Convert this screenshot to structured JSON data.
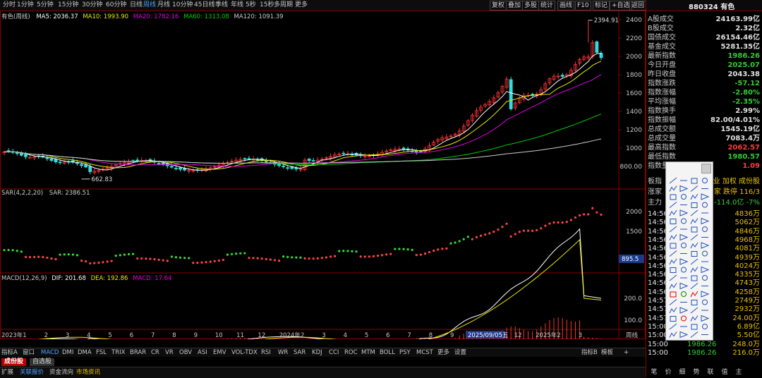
{
  "topbar": {
    "tabs": [
      "分时",
      "1分钟",
      "5分钟",
      "15分钟",
      "30分钟",
      "60分钟",
      "日线",
      "周线",
      "月线",
      "10分钟",
      "45日线",
      "季线",
      "年线",
      "5秒",
      "15秒",
      "多周期",
      "更多"
    ],
    "active": "周线",
    "buttons": [
      "复权",
      "叠加",
      "多股",
      "统计",
      "画线",
      "F10",
      "标记",
      "+自选",
      "返回"
    ]
  },
  "main_legend": {
    "name": "有色(周线)",
    "ma5": "MA5: 2036.37",
    "ma10": "MA10: 1993.90",
    "ma20": "MA20: 1782.16",
    "ma60": "MA60: 1313.08",
    "ma120": "MA120: 1091.39"
  },
  "sar_legend": {
    "name": "SAR(4,2,2,20)",
    "value": "SAR: 2386.51"
  },
  "macd_legend": {
    "name": "MACD(12,26,9)",
    "dif": "DIF: 201.68",
    "dea": "DEA: 192.86",
    "macd": "MACD: 17.64"
  },
  "axis": {
    "price_ticks": [
      "2400",
      "2200",
      "2000",
      "1800",
      "1600",
      "1400",
      "1200",
      "1000",
      "800.00"
    ],
    "sar_ticks": [
      "2000",
      "1500"
    ],
    "sar_box": "895.5",
    "macd_ticks": [
      "200.0",
      "100.0"
    ],
    "high_label": "2394.91",
    "low_label": "662.83",
    "time_labels": [
      "2023年",
      "1",
      "2",
      "3",
      "4",
      "5",
      "6",
      "7",
      "8",
      "9",
      "10",
      "11",
      "12",
      "2024年",
      "2",
      "3",
      "4",
      "5",
      "6",
      "7",
      "8",
      "9",
      "10",
      "11",
      "12",
      "2025年",
      "2",
      "3"
    ],
    "date_box": "2025/09/05五",
    "period_label": "周线"
  },
  "bottom_tabs": [
    "指标A",
    "窗口",
    "MACD",
    "DMI",
    "DMA",
    "FSL",
    "TRIX",
    "BRAR",
    "CR",
    "VR",
    "OBV",
    "ASI",
    "EMV",
    "VOL-TDX",
    "RSI",
    "WR",
    "SAR",
    "KDJ",
    "CCI",
    "ROC",
    "MTM",
    "BOLL",
    "PSY",
    "MCST",
    "更多",
    "设置"
  ],
  "bottom_right": [
    "指标B",
    "模板",
    "+"
  ],
  "stock_tabs": [
    "成份股",
    "自选股"
  ],
  "status_tabs": [
    "扩展",
    "关联报价",
    "资金流向",
    "市场资讯"
  ],
  "right_panel": {
    "title": "880324 有色",
    "rows": [
      {
        "label": "A股成交",
        "value": "24163.99亿",
        "color": "#e0e0e0"
      },
      {
        "label": "B股成交",
        "value": "2.32亿",
        "color": "#e0e0e0"
      },
      {
        "label": "国债成交",
        "value": "26154.46亿",
        "color": "#e0e0e0"
      },
      {
        "label": "基金成交",
        "value": "5281.35亿",
        "color": "#e0e0e0"
      },
      {
        "label": "最新指数",
        "value": "1986.26",
        "color": "#33cc33"
      },
      {
        "label": "今日开盘",
        "value": "2025.07",
        "color": "#33cc33"
      },
      {
        "label": "昨日收盘",
        "value": "2043.38",
        "color": "#e0e0e0"
      },
      {
        "label": "指数涨跌",
        "value": "-57.12",
        "color": "#33cc33"
      },
      {
        "label": "指数涨幅",
        "value": "-2.80%",
        "color": "#33cc33"
      },
      {
        "label": "平均涨幅",
        "value": "-2.35%",
        "color": "#33cc33"
      },
      {
        "label": "指数换手",
        "value": "2.99%",
        "color": "#e0e0e0"
      },
      {
        "label": "指数振幅",
        "value": "82.00/4.01%",
        "color": "#e0e0e0"
      },
      {
        "label": "总成交额",
        "value": "1545.19亿",
        "color": "#e0e0e0"
      },
      {
        "label": "总成交量",
        "value": "7083.4万",
        "color": "#e0e0e0"
      },
      {
        "label": "最高指数",
        "value": "2062.57",
        "color": "#ff3b3b"
      },
      {
        "label": "最低指数",
        "value": "1980.57",
        "color": "#33cc33"
      },
      {
        "label": "指数量比",
        "value": "1.09",
        "color": "#ff3b3b"
      }
    ],
    "partial_rows": [
      {
        "left": "板指",
        "right": "业 加权 成份股"
      },
      {
        "left": "涨家",
        "right": "家 跌停 116/3"
      },
      {
        "left": "主力",
        "right": "-114.0亿 -7%"
      }
    ],
    "ticks": [
      {
        "time": "14:56",
        "value": "4836万"
      },
      {
        "time": "14:56",
        "value": "5062万"
      },
      {
        "time": "14:56",
        "value": "4846万"
      },
      {
        "time": "14:56",
        "value": "4968万"
      },
      {
        "time": "14:56",
        "value": "4081万"
      },
      {
        "time": "14:56",
        "value": "4939万"
      },
      {
        "time": "14:56",
        "value": "4024万"
      },
      {
        "time": "14:56",
        "value": "4335万"
      },
      {
        "time": "14:56",
        "value": "4743万"
      },
      {
        "time": "14:56",
        "value": "4258万"
      },
      {
        "time": "14:57",
        "value": "2749万"
      },
      {
        "time": "14:57",
        "value": "2932万"
      },
      {
        "time": "14:57",
        "value": "24.00万"
      },
      {
        "time": "15:00",
        "value": "6.89亿"
      },
      {
        "time": "15:00",
        "value": "5.50亿"
      },
      {
        "time": "15:00",
        "price": "1986.26",
        "value": "248.0万"
      },
      {
        "time": "15:00",
        "price": "1986.26",
        "value": "216.0万"
      }
    ],
    "bottom_tabs": [
      "笔",
      "价",
      "细",
      "势",
      "联",
      "值",
      "主"
    ]
  },
  "colors": {
    "up": "#ff3333",
    "down": "#33dddd",
    "ma5": "#ffffff",
    "ma10": "#e8e800",
    "ma20": "#e000e0",
    "ma60": "#00cc00",
    "ma120": "#cccccc",
    "grid": "#8a0000"
  }
}
